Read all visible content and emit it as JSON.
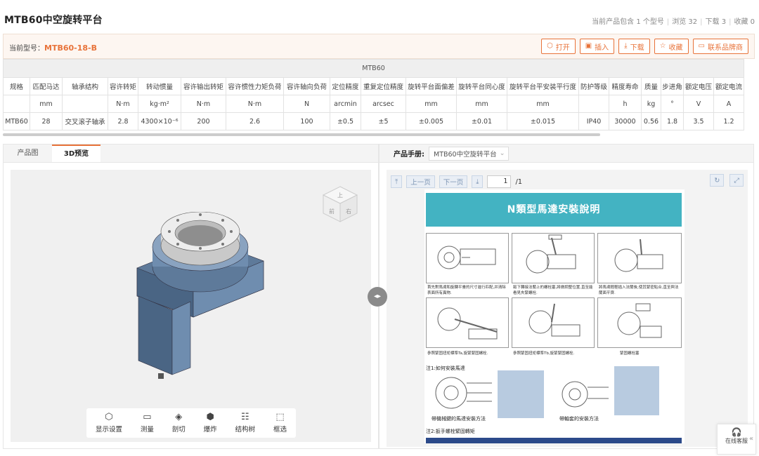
{
  "header": {
    "title": "MTB60中空旋转平台",
    "stats": {
      "products": "当前产品包含 1 个型号",
      "views": "浏览 32",
      "downloads": "下载 3",
      "favorites": "收藏 0"
    }
  },
  "model_bar": {
    "label": "当前型号：",
    "value": "MTB60-18-B",
    "actions": {
      "open": "打开",
      "insert": "插入",
      "download": "下载",
      "favorite": "收藏",
      "contact": "联系品牌商"
    }
  },
  "spec_table": {
    "group": "MTB60",
    "headers": [
      "规格",
      "匹配马达",
      "轴承结构",
      "容许转矩",
      "转动惯量",
      "容许输出转矩",
      "容许惯性力矩负荷",
      "容许轴向负荷",
      "定位精度",
      "重复定位精度",
      "旋转平台面偏差",
      "旋转平台同心度",
      "旋转平台平安装平行度",
      "防护等级",
      "精度寿命",
      "质量",
      "步进角",
      "额定电压",
      "额定电流"
    ],
    "units": [
      "",
      "mm",
      "",
      "N·m",
      "kg·m²",
      "N·m",
      "N·m",
      "N",
      "arcmin",
      "arcsec",
      "mm",
      "mm",
      "mm",
      "",
      "h",
      "kg",
      "°",
      "V",
      "A"
    ],
    "row": [
      "MTB60",
      "28",
      "交叉滚子轴承",
      "2.8",
      "4300×10⁻⁶",
      "200",
      "2.6",
      "100",
      "±0.5",
      "±5",
      "±0.005",
      "±0.01",
      "±0.015",
      "IP40",
      "30000",
      "0.56",
      "1.8",
      "3.5",
      "1.2"
    ]
  },
  "left_panel": {
    "tabs": [
      "产品图",
      "3D预览"
    ],
    "cube": {
      "top": "上",
      "front": "前",
      "right": "右"
    },
    "tools": [
      "显示设置",
      "测量",
      "剖切",
      "爆炸",
      "结构树",
      "框选"
    ]
  },
  "right_panel": {
    "label": "产品手册:",
    "selected_manual": "MTB60中空旋转平台",
    "pdf": {
      "first": "",
      "prev": "上一页",
      "next": "下一页",
      "last": "",
      "page": "1",
      "total": "/1",
      "banner": "N類型馬達安裝說明",
      "caption_1": "首先對馬達和旋轉平臺的尺寸進行匹配,并清除表面所有異物.",
      "caption_2": "鬆下轉接法蘭上的螺栓塞,將做調整位置,直至能看見夾緊螺栓.",
      "caption_3": "將馬達輕輕插入法蘭後,使其緊密貼合,直至與法蘭面平齊.",
      "caption_4": "參照緊固扭矩標準Ta,旋緊緊固螺栓.",
      "caption_5": "參照緊固扭矩標準Tb,旋緊緊固螺栓.",
      "caption_6": "緊固螺栓塞",
      "note_1": "注1:如何安裝馬達",
      "keyed_label": "帶機械鍵的馬達安裝方法",
      "sleeve_label": "帶軸套的安裝方法",
      "note_2": "注2:扳手螺栓緊固轉矩"
    }
  },
  "support": {
    "label": "在线客服"
  }
}
